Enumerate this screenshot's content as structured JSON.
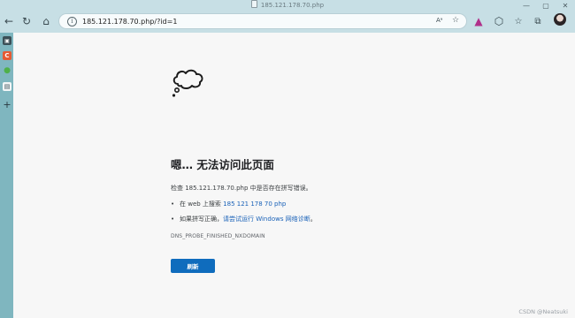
{
  "browser": {
    "tab_title": "185.121.178.70.php",
    "address": "185.121.178.70.php/?id=1",
    "window_controls": {
      "minimize": "—",
      "maximize": "▢",
      "close": "✕"
    },
    "nav": {
      "back_icon": "←",
      "refresh_icon": "↻",
      "home_icon": "⌂"
    }
  },
  "sidebar": {
    "items": [
      {
        "name": "tabs-icon",
        "glyph": "▣"
      },
      {
        "name": "csdn-icon",
        "glyph": "C"
      },
      {
        "name": "green-extension-icon",
        "glyph": "●"
      },
      {
        "name": "wallet-icon",
        "glyph": "▤"
      },
      {
        "name": "add-icon",
        "glyph": "+"
      }
    ]
  },
  "error": {
    "heading": "嗯… 无法访问此页面",
    "check_line": "检查 185.121.178.70.php 中是否存在拼写错误。",
    "bullet1_prefix": "在 web 上搜索 ",
    "bullet1_link": "185 121 178 70 php",
    "bullet2_prefix": "如果拼写正确，",
    "bullet2_link": "请尝试运行 Windows 网络诊断",
    "bullet2_suffix": "。",
    "code": "DNS_PROBE_FINISHED_NXDOMAIN",
    "reload_label": "刷新"
  },
  "watermark": "CSDN @Neatsuki",
  "colors": {
    "accent": "#0f6cbd",
    "link": "#1a62b8",
    "sidebar": "#7fb6bf",
    "chrome": "#c7dfe5"
  }
}
